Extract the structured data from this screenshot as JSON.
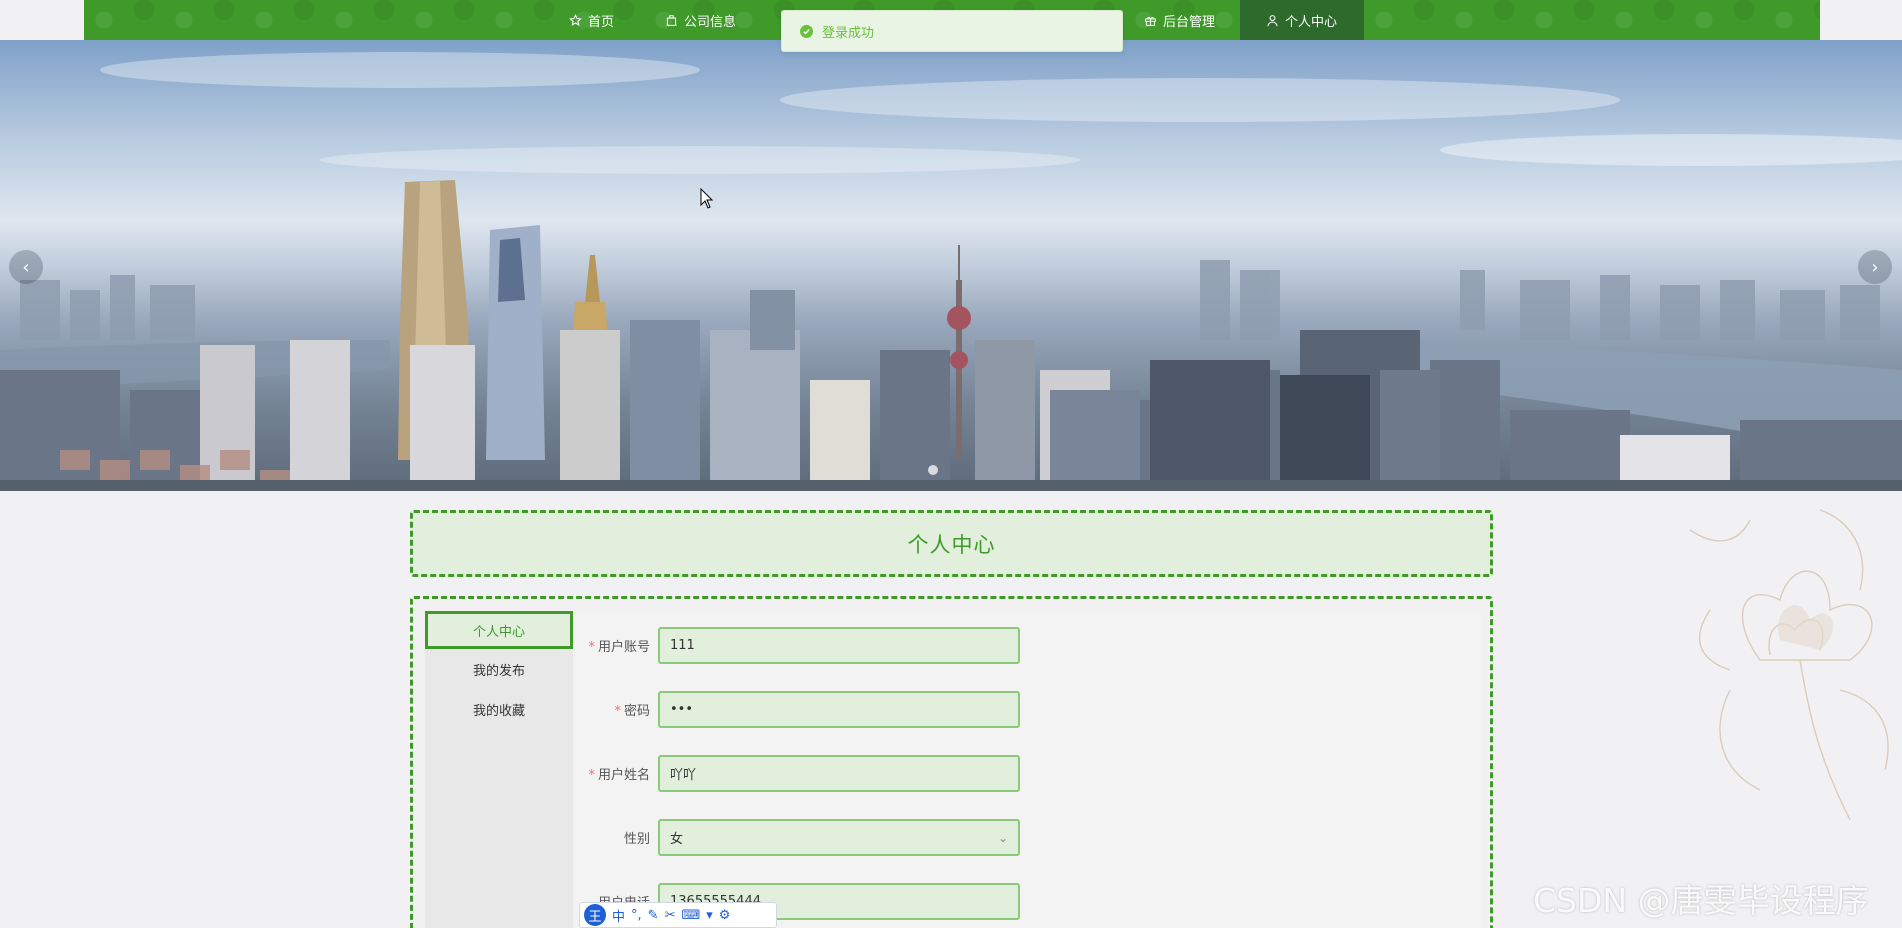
{
  "nav": {
    "items": [
      {
        "label": "首页",
        "icon": "star-icon"
      },
      {
        "label": "公司信息",
        "icon": "building-icon"
      },
      {
        "label": "后台管理",
        "icon": "gift-icon"
      },
      {
        "label": "个人中心",
        "icon": "user-icon",
        "active": true
      }
    ],
    "color": "#3f9a2a",
    "active_color": "#2f6a2d"
  },
  "toast": {
    "message": "登录成功",
    "type": "success"
  },
  "banner": {
    "prev": "‹",
    "next": "›"
  },
  "page_title": "个人中心",
  "side_menu": {
    "items": [
      {
        "label": "个人中心",
        "active": true
      },
      {
        "label": "我的发布"
      },
      {
        "label": "我的收藏"
      }
    ]
  },
  "form": {
    "account": {
      "label": "用户账号",
      "value": "111",
      "required": true
    },
    "password": {
      "label": "密码",
      "value": "•••",
      "required": true
    },
    "name": {
      "label": "用户姓名",
      "value": "吖吖",
      "required": true
    },
    "gender": {
      "label": "性别",
      "value": "女",
      "required": false
    },
    "phone": {
      "label": "用户电话",
      "value": "13655555444",
      "required": false
    }
  },
  "ime_toolbar": {
    "logo": "王",
    "mode": "中"
  },
  "watermark": "CSDN @唐雯毕设程序"
}
